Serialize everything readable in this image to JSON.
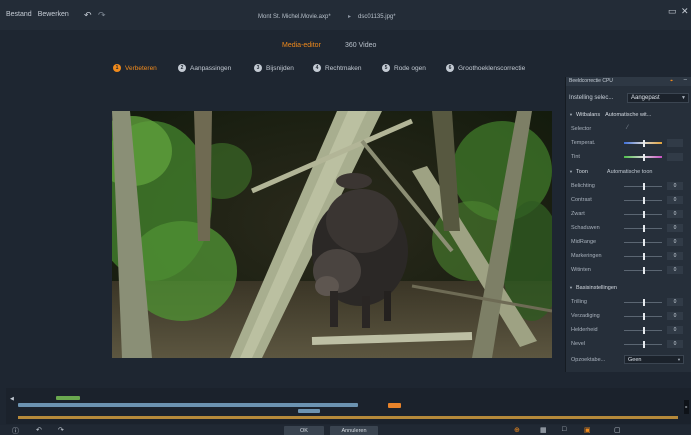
{
  "titlebar": {
    "menu": [
      "Bestand",
      "Bewerken"
    ],
    "document": "Mont St. Michel.Movie.axp*",
    "file": "dsc01135.jpg*",
    "icons": {
      "undo": "undo-icon",
      "redo": "redo-icon",
      "minimize": "minimize-icon",
      "close": "close-icon"
    }
  },
  "modes": {
    "media_editor": "Media-editor",
    "video360": "360 Video"
  },
  "steps": [
    {
      "num": "1",
      "label": "Verbeteren",
      "active": true
    },
    {
      "num": "2",
      "label": "Aanpassingen",
      "active": false
    },
    {
      "num": "3",
      "label": "Bijsnijden",
      "active": false
    },
    {
      "num": "4",
      "label": "Rechtmaken",
      "active": false
    },
    {
      "num": "5",
      "label": "Rode ogen",
      "active": false
    },
    {
      "num": "6",
      "label": "Groothoeklenscorrectie",
      "active": false
    }
  ],
  "panel": {
    "title": "Beeldcorrectie CPU",
    "preset_label": "Instelling selec...",
    "preset_value": "Aangepast",
    "white_balance": {
      "header": "Witbalans",
      "header_auto": "Automatische wit...",
      "selector_label": "Selector",
      "rows": [
        {
          "label": "Temperat.",
          "value": ""
        },
        {
          "label": "Tint",
          "value": ""
        }
      ]
    },
    "tone": {
      "header": "Toon",
      "header_auto": "Automatische toon",
      "rows": [
        {
          "label": "Belichting",
          "value": "0"
        },
        {
          "label": "Contrast",
          "value": "0"
        },
        {
          "label": "Zwart",
          "value": "0"
        },
        {
          "label": "Schaduwen",
          "value": "0"
        },
        {
          "label": "MidRange",
          "value": "0"
        },
        {
          "label": "Markeringen",
          "value": "0"
        },
        {
          "label": "Witinten",
          "value": "0"
        }
      ]
    },
    "basic": {
      "header": "Basisinstellingen",
      "rows": [
        {
          "label": "Trilling",
          "value": "0"
        },
        {
          "label": "Verzadiging",
          "value": "0"
        },
        {
          "label": "Helderheid",
          "value": "0"
        },
        {
          "label": "Nevel",
          "value": "0"
        }
      ]
    },
    "dropdown": {
      "label": "Opzoektabe...",
      "value": "Geen"
    }
  },
  "bottom": {
    "ok": "OK",
    "cancel": "Annuleren"
  },
  "colors": {
    "accent": "#f08a1c",
    "background": "#1e2631",
    "panel": "#262f3a"
  }
}
